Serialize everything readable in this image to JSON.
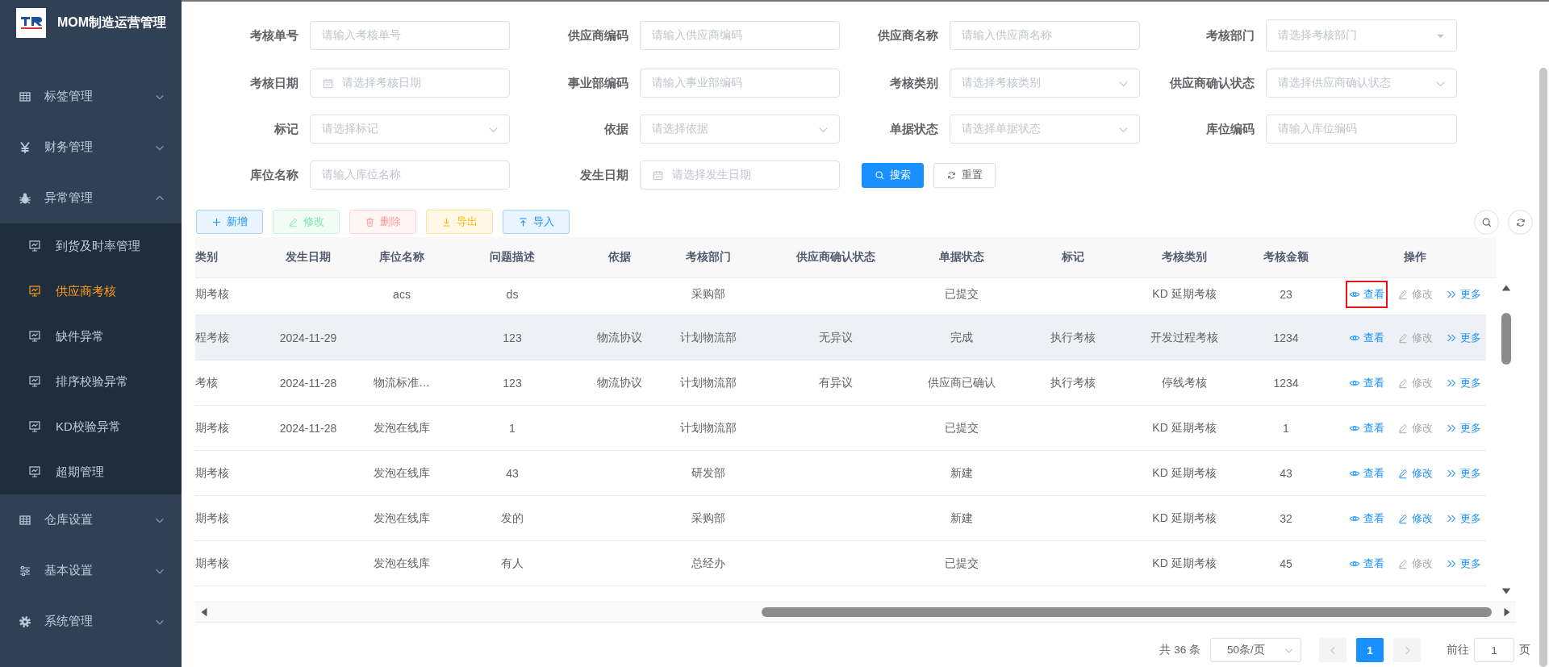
{
  "sidebar": {
    "title": "MOM制造运营管理",
    "items": [
      {
        "label": "标签管理",
        "expanded": false
      },
      {
        "label": "财务管理",
        "expanded": false
      },
      {
        "label": "异常管理",
        "expanded": true,
        "children": [
          {
            "label": "到货及时率管理",
            "selected": false
          },
          {
            "label": "供应商考核",
            "selected": true
          },
          {
            "label": "缺件异常",
            "selected": false
          },
          {
            "label": "排序校验异常",
            "selected": false
          },
          {
            "label": "KD校验异常",
            "selected": false
          },
          {
            "label": "超期管理",
            "selected": false
          }
        ]
      },
      {
        "label": "仓库设置",
        "expanded": false
      },
      {
        "label": "基本设置",
        "expanded": false
      },
      {
        "label": "系统管理",
        "expanded": false
      }
    ]
  },
  "search_form": {
    "fields": [
      {
        "label": "考核单号",
        "kind": "input",
        "placeholder": "请输入考核单号"
      },
      {
        "label": "供应商编码",
        "kind": "input",
        "placeholder": "请输入供应商编码"
      },
      {
        "label": "供应商名称",
        "kind": "input",
        "placeholder": "请输入供应商名称"
      },
      {
        "label": "考核部门",
        "kind": "select-solid",
        "placeholder": "请选择考核部门"
      },
      {
        "label": "考核日期",
        "kind": "date",
        "placeholder": "请选择考核日期"
      },
      {
        "label": "事业部编码",
        "kind": "input",
        "placeholder": "请输入事业部编码"
      },
      {
        "label": "考核类别",
        "kind": "select",
        "placeholder": "请选择考核类别"
      },
      {
        "label": "供应商确认状态",
        "kind": "select",
        "placeholder": "请选择供应商确认状态"
      },
      {
        "label": "标记",
        "kind": "select",
        "placeholder": "请选择标记"
      },
      {
        "label": "依据",
        "kind": "select",
        "placeholder": "请选择依据"
      },
      {
        "label": "单据状态",
        "kind": "select",
        "placeholder": "请选择单据状态"
      },
      {
        "label": "库位编码",
        "kind": "input",
        "placeholder": "请输入库位编码"
      },
      {
        "label": "库位名称",
        "kind": "input",
        "placeholder": "请输入库位名称"
      },
      {
        "label": "发生日期",
        "kind": "date",
        "placeholder": "请选择发生日期"
      }
    ],
    "buttons": [
      {
        "label": "搜索",
        "kind": "search"
      },
      {
        "label": "重置",
        "kind": "reset"
      }
    ]
  },
  "toolbar": {
    "buttons": [
      {
        "label": "新增",
        "kind": "add",
        "disabled": false
      },
      {
        "label": "修改",
        "kind": "edit",
        "disabled": true
      },
      {
        "label": "删除",
        "kind": "delete",
        "disabled": true
      },
      {
        "label": "导出",
        "kind": "export",
        "disabled": false
      },
      {
        "label": "导入",
        "kind": "import",
        "disabled": false
      }
    ]
  },
  "table": {
    "columns": [
      "类别",
      "发生日期",
      "库位名称",
      "问题描述",
      "依据",
      "考核部门",
      "供应商确认状态",
      "单据状态",
      "标记",
      "考核类别",
      "考核金额",
      "操作"
    ],
    "rows": [
      {
        "hovered": false,
        "cells": [
          "期考核",
          null,
          "acs",
          "ds",
          null,
          "采购部",
          null,
          "已提交",
          null,
          "KD 延期考核",
          "23"
        ],
        "actions": [
          {
            "kind": "view",
            "label": "查看",
            "disabled": false,
            "highlighted": true
          },
          {
            "kind": "edit",
            "label": "修改",
            "disabled": true,
            "highlighted": false
          },
          {
            "kind": "more",
            "label": "更多",
            "disabled": false,
            "highlighted": false
          }
        ]
      },
      {
        "hovered": true,
        "cells": [
          "程考核",
          "2024-11-29",
          null,
          "123",
          "物流协议",
          "计划物流部",
          "无异议",
          "完成",
          "执行考核",
          "开发过程考核",
          "1234"
        ],
        "actions": [
          {
            "kind": "view",
            "label": "查看",
            "disabled": false,
            "highlighted": false
          },
          {
            "kind": "edit",
            "label": "修改",
            "disabled": true,
            "highlighted": false
          },
          {
            "kind": "more",
            "label": "更多",
            "disabled": false,
            "highlighted": false
          }
        ]
      },
      {
        "hovered": false,
        "cells": [
          "考核",
          "2024-11-28",
          "物流标准…",
          "123",
          "物流协议",
          "计划物流部",
          "有异议",
          "供应商已确认",
          "执行考核",
          "停线考核",
          "1234"
        ],
        "actions": [
          {
            "kind": "view",
            "label": "查看",
            "disabled": false,
            "highlighted": false
          },
          {
            "kind": "edit",
            "label": "修改",
            "disabled": true,
            "highlighted": false
          },
          {
            "kind": "more",
            "label": "更多",
            "disabled": false,
            "highlighted": false
          }
        ]
      },
      {
        "hovered": false,
        "cells": [
          "期考核",
          "2024-11-28",
          "发泡在线库",
          "1",
          null,
          "计划物流部",
          null,
          "已提交",
          null,
          "KD 延期考核",
          "1"
        ],
        "actions": [
          {
            "kind": "view",
            "label": "查看",
            "disabled": false,
            "highlighted": false
          },
          {
            "kind": "edit",
            "label": "修改",
            "disabled": true,
            "highlighted": false
          },
          {
            "kind": "more",
            "label": "更多",
            "disabled": false,
            "highlighted": false
          }
        ]
      },
      {
        "hovered": false,
        "cells": [
          "期考核",
          null,
          "发泡在线库",
          "43",
          null,
          "研发部",
          null,
          "新建",
          null,
          "KD 延期考核",
          "43"
        ],
        "actions": [
          {
            "kind": "view",
            "label": "查看",
            "disabled": false,
            "highlighted": false
          },
          {
            "kind": "edit",
            "label": "修改",
            "disabled": false,
            "highlighted": false
          },
          {
            "kind": "more",
            "label": "更多",
            "disabled": false,
            "highlighted": false
          }
        ]
      },
      {
        "hovered": false,
        "cells": [
          "期考核",
          null,
          "发泡在线库",
          "发的",
          null,
          "采购部",
          null,
          "新建",
          null,
          "KD 延期考核",
          "32"
        ],
        "actions": [
          {
            "kind": "view",
            "label": "查看",
            "disabled": false,
            "highlighted": false
          },
          {
            "kind": "edit",
            "label": "修改",
            "disabled": false,
            "highlighted": false
          },
          {
            "kind": "more",
            "label": "更多",
            "disabled": false,
            "highlighted": false
          }
        ]
      },
      {
        "hovered": false,
        "cells": [
          "期考核",
          null,
          "发泡在线库",
          "有人",
          null,
          "总经办",
          null,
          "已提交",
          null,
          "KD 延期考核",
          "45"
        ],
        "actions": [
          {
            "kind": "view",
            "label": "查看",
            "disabled": false,
            "highlighted": false
          },
          {
            "kind": "edit",
            "label": "修改",
            "disabled": true,
            "highlighted": false
          },
          {
            "kind": "more",
            "label": "更多",
            "disabled": false,
            "highlighted": false
          }
        ]
      }
    ]
  },
  "pagination": {
    "total": "共 36 条",
    "page_size": "50条/页",
    "pages": [
      {
        "label": "1",
        "selected": true
      }
    ],
    "goto_label": "前往",
    "goto_value": "1",
    "page_suffix": "页"
  }
}
